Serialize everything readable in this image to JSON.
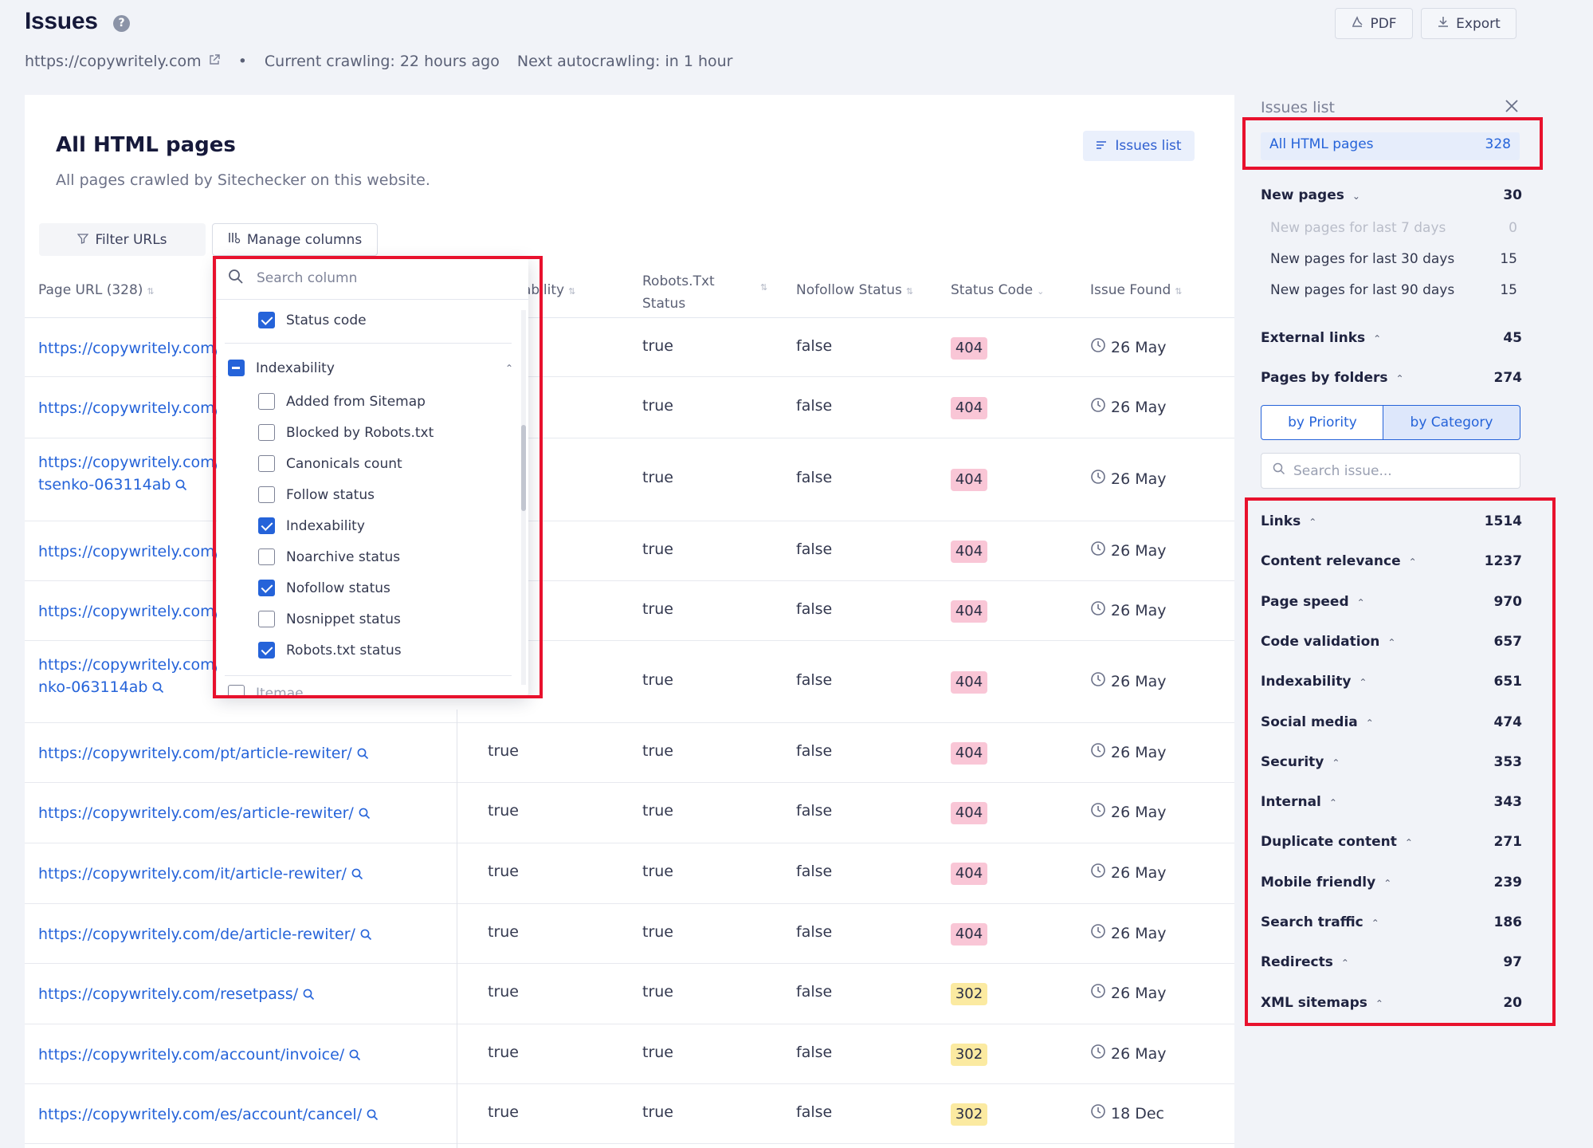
{
  "header": {
    "title": "Issues",
    "help_glyph": "?",
    "pdf_label": "PDF",
    "export_label": "Export",
    "site_url": "https://copywritely.com",
    "bullet": "•",
    "current_crawl": "Current crawling: 22 hours ago",
    "next_crawl": "Next autocrawling: in 1 hour"
  },
  "main": {
    "title": "All HTML pages",
    "description": "All pages crawled by Sitechecker on this website.",
    "issues_list_button": "Issues list",
    "filter_label": "Filter URLs",
    "manage_columns_label": "Manage columns"
  },
  "table": {
    "headers": {
      "page_url": "Page URL (328)",
      "indexability_partial": "ability",
      "robots_line1": "Robots.Txt",
      "robots_line2": "Status",
      "nofollow": "Nofollow Status",
      "status_code": "Status Code",
      "issue_found": "Issue Found"
    },
    "rows": [
      {
        "url": "https://copywritely.com/a",
        "url2": "",
        "indexability": "",
        "robots": "true",
        "nofollow": "false",
        "status": "404",
        "date": "26 May"
      },
      {
        "url": "https://copywritely.com/p",
        "url2": "",
        "indexability": "",
        "robots": "true",
        "nofollow": "false",
        "status": "404",
        "date": "26 May"
      },
      {
        "url": "https://copywritely.com/r",
        "url2": "tsenko-063114ab",
        "indexability": "",
        "robots": "true",
        "nofollow": "false",
        "status": "404",
        "date": "26 May"
      },
      {
        "url": "https://copywritely.com/t",
        "url2": "",
        "indexability": "",
        "robots": "true",
        "nofollow": "false",
        "status": "404",
        "date": "26 May"
      },
      {
        "url": "https://copywritely.com/t",
        "url2": "",
        "indexability": "",
        "robots": "true",
        "nofollow": "false",
        "status": "404",
        "date": "26 May"
      },
      {
        "url": "https://copywritely.com/v",
        "url2": "nko-063114ab",
        "indexability": "",
        "robots": "true",
        "nofollow": "false",
        "status": "404",
        "date": "26 May"
      },
      {
        "url": "https://copywritely.com/pt/article-rewiter/",
        "url2": "",
        "indexability": "true",
        "robots": "true",
        "nofollow": "false",
        "status": "404",
        "date": "26 May"
      },
      {
        "url": "https://copywritely.com/es/article-rewiter/",
        "url2": "",
        "indexability": "true",
        "robots": "true",
        "nofollow": "false",
        "status": "404",
        "date": "26 May"
      },
      {
        "url": "https://copywritely.com/it/article-rewiter/",
        "url2": "",
        "indexability": "true",
        "robots": "true",
        "nofollow": "false",
        "status": "404",
        "date": "26 May"
      },
      {
        "url": "https://copywritely.com/de/article-rewiter/",
        "url2": "",
        "indexability": "true",
        "robots": "true",
        "nofollow": "false",
        "status": "404",
        "date": "26 May"
      },
      {
        "url": "https://copywritely.com/resetpass/",
        "url2": "",
        "indexability": "true",
        "robots": "true",
        "nofollow": "false",
        "status": "302",
        "date": "26 May"
      },
      {
        "url": "https://copywritely.com/account/invoice/",
        "url2": "",
        "indexability": "true",
        "robots": "true",
        "nofollow": "false",
        "status": "302",
        "date": "26 May"
      },
      {
        "url": "https://copywritely.com/es/account/cancel/",
        "url2": "",
        "indexability": "true",
        "robots": "true",
        "nofollow": "false",
        "status": "302",
        "date": "18 Dec"
      }
    ]
  },
  "column_menu": {
    "search_placeholder": "Search column",
    "status_code": "Status code",
    "group_label": "Indexability",
    "items": [
      {
        "label": "Added from Sitemap",
        "checked": false
      },
      {
        "label": "Blocked by Robots.txt",
        "checked": false
      },
      {
        "label": "Canonicals count",
        "checked": false
      },
      {
        "label": "Follow status",
        "checked": false
      },
      {
        "label": "Indexability",
        "checked": true
      },
      {
        "label": "Noarchive status",
        "checked": false
      },
      {
        "label": "Nofollow status",
        "checked": true
      },
      {
        "label": "Nosnippet status",
        "checked": false
      },
      {
        "label": "Robots.txt status",
        "checked": true
      }
    ],
    "cut_item": "Itemae"
  },
  "sidebar": {
    "title": "Issues list",
    "active": {
      "label": "All HTML pages",
      "count": "328"
    },
    "new_pages": {
      "label": "New pages",
      "count": "30"
    },
    "new_sub": [
      {
        "label": "New pages for last 7 days",
        "count": "0"
      },
      {
        "label": "New pages for last 30 days",
        "count": "15"
      },
      {
        "label": "New pages for last 90 days",
        "count": "15"
      }
    ],
    "external_links": {
      "label": "External links",
      "count": "45"
    },
    "pages_by_folders": {
      "label": "Pages by folders",
      "count": "274"
    },
    "seg_priority": "by Priority",
    "seg_category": "by Category",
    "search_placeholder": "Search issue...",
    "categories": [
      {
        "label": "Links",
        "count": "1514"
      },
      {
        "label": "Content relevance",
        "count": "1237"
      },
      {
        "label": "Page speed",
        "count": "970"
      },
      {
        "label": "Code validation",
        "count": "657"
      },
      {
        "label": "Indexability",
        "count": "651"
      },
      {
        "label": "Social media",
        "count": "474"
      },
      {
        "label": "Security",
        "count": "353"
      },
      {
        "label": "Internal",
        "count": "343"
      },
      {
        "label": "Duplicate content",
        "count": "271"
      },
      {
        "label": "Mobile friendly",
        "count": "239"
      },
      {
        "label": "Search traffic",
        "count": "186"
      },
      {
        "label": "Redirects",
        "count": "97"
      },
      {
        "label": "XML sitemaps",
        "count": "20"
      }
    ]
  },
  "colors": {
    "accent": "#2563d9",
    "highlight": "#e8112d",
    "badge_404": "#f9c6d6",
    "badge_302": "#fbeaa1"
  },
  "icons": [
    "help-icon",
    "pdf-icon",
    "download-icon",
    "external-link-icon",
    "filter-icon",
    "columns-icon",
    "list-icon",
    "sort-icon",
    "search-icon",
    "clock-icon",
    "close-icon",
    "chevron-icon",
    "checkbox-icon"
  ]
}
